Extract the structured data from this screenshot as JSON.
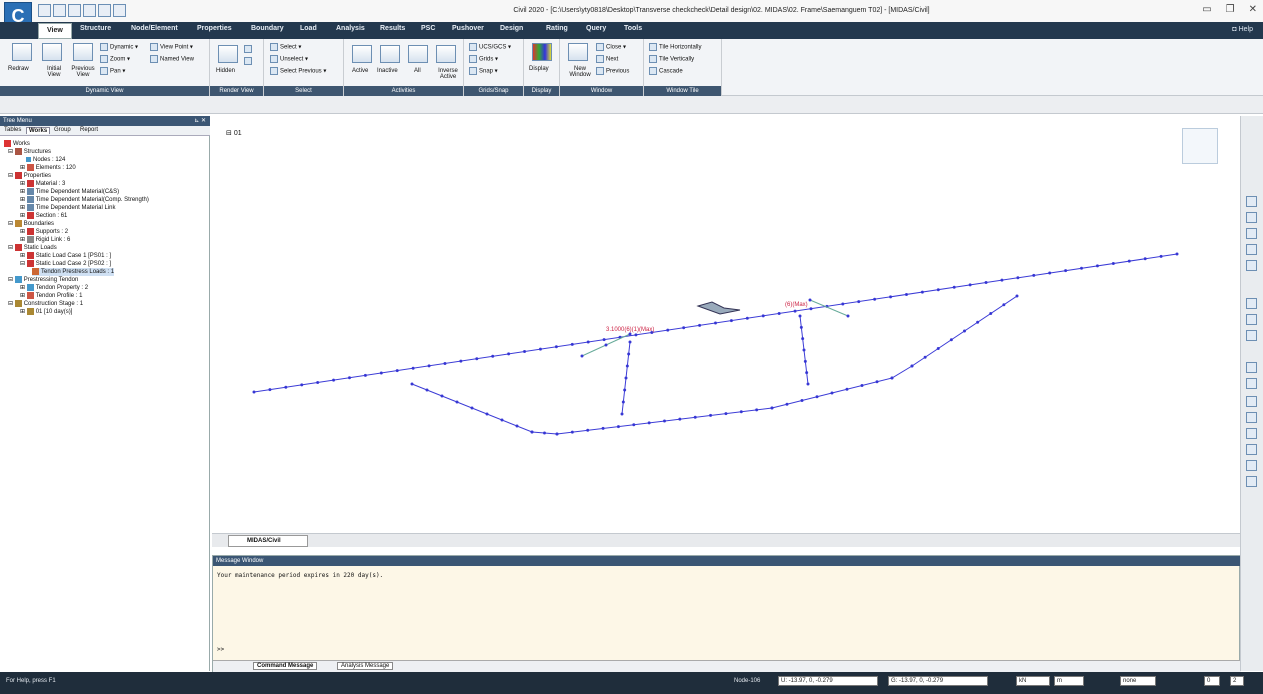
{
  "app": {
    "title": "Civil 2020 - [C:\\Users\\yty0818\\Desktop\\Transverse checkcheck\\Detail design\\02. MIDAS\\02. Frame\\Saemanguem T02] - [MIDAS/Civil]",
    "logo": "C"
  },
  "menu_tabs": [
    "View",
    "Structure",
    "Node/Element",
    "Properties",
    "Boundary",
    "Load",
    "Analysis",
    "Results",
    "PSC",
    "Pushover",
    "Design",
    "Rating",
    "Query",
    "Tools"
  ],
  "help_label": "Help",
  "ribbon": {
    "groups": [
      {
        "label": "Dynamic View",
        "items": [
          "Redraw",
          "Initial View",
          "Previous View",
          "Dynamic",
          "Zoom",
          "Pan",
          "View Point",
          "Named View"
        ]
      },
      {
        "label": "Render View",
        "items": [
          "Hidden"
        ]
      },
      {
        "label": "Select",
        "items": [
          "Select",
          "Unselect",
          "Select Previous"
        ]
      },
      {
        "label": "Activities",
        "items": [
          "Active",
          "Inactive",
          "All",
          "Inverse Active"
        ]
      },
      {
        "label": "Grids/Snap",
        "items": [
          "UCS/GCS",
          "Grids",
          "Snap"
        ]
      },
      {
        "label": "Display",
        "items": [
          "Display"
        ]
      },
      {
        "label": "Window",
        "items": [
          "New Window",
          "Close",
          "Next",
          "Previous"
        ]
      },
      {
        "label": "Window Tile",
        "items": [
          "Tile Horizontally",
          "Tile Vertically",
          "Cascade"
        ]
      }
    ]
  },
  "tree": {
    "header": "Tree Menu",
    "tabs": [
      "Tables",
      "Works",
      "Group",
      "Report"
    ],
    "items": [
      "Works",
      "Structures",
      "Nodes : 124",
      "Elements : 120",
      "Properties",
      "Material : 3",
      "Time Dependent Material(C&S)",
      "Time Dependent Material(Comp. Strength)",
      "Time Dependent Material Link",
      "Section : 61",
      "Boundaries",
      "Supports : 2",
      "Rigid Link : 6",
      "Static Loads",
      "Static Load Case 1 [PS01 : ]",
      "Static Load Case 2 [PS02 : ]",
      "Tendon Prestress Loads : 1",
      "Prestressing Tendon",
      "Tendon Property : 2",
      "Tendon Profile : 1",
      "Construction Stage : 1",
      "01 [10 day(s)]"
    ]
  },
  "canvas": {
    "stage_label": "01",
    "annotations": [
      "3.1000(6)(1)(Max)",
      "(6)(Max)"
    ]
  },
  "view_tab": "MIDAS/Civil",
  "message": {
    "header": "Message Window",
    "text": "Your maintenance period expires in 220 day(s).",
    "prompt": ">>",
    "tabs": [
      "Command Message",
      "Analysis Message"
    ]
  },
  "status": {
    "help": "For Help, press F1",
    "node": "Node-106",
    "u": "U: -13.97, 0, -0.279",
    "g": "G: -13.97, 0, -0.279",
    "force_unit": "kN",
    "length_unit": "m",
    "combo": "none",
    "page_a": "0",
    "page_b": "2"
  }
}
